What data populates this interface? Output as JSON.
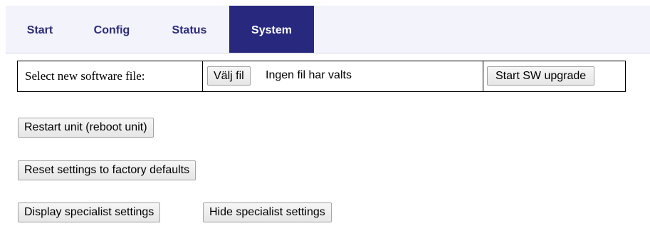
{
  "nav": {
    "tabs": [
      {
        "label": "Start",
        "active": false
      },
      {
        "label": "Config",
        "active": false
      },
      {
        "label": "Status",
        "active": false
      },
      {
        "label": "System",
        "active": true
      }
    ]
  },
  "upgrade": {
    "select_label": "Select new software file:",
    "choose_file_button": "Välj fil",
    "file_status": "Ingen fil har valts",
    "start_button": "Start SW upgrade"
  },
  "actions": {
    "restart_button": "Restart unit (reboot unit)",
    "reset_button": "Reset settings to factory defaults",
    "display_specialist_button": "Display specialist settings",
    "hide_specialist_button": "Hide specialist settings"
  },
  "colors": {
    "active_tab_bg": "#28287e",
    "tab_text": "#2c2c7a",
    "nav_bg": "#f3f3fb"
  }
}
